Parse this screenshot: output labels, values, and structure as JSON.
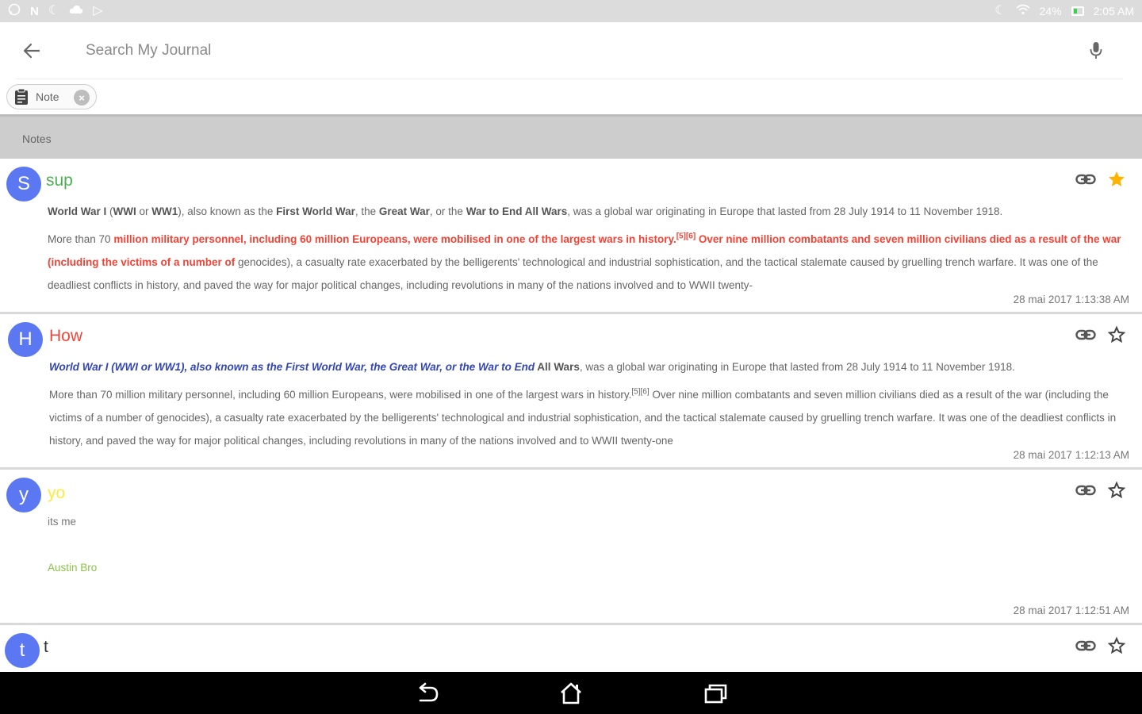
{
  "status_bar": {
    "left_icons": [
      "whatsapp-icon",
      "n-notification-icon",
      "moon-icon",
      "cloud-icon",
      "play-store-icon"
    ],
    "battery": "24%",
    "time": "2:05 AM"
  },
  "search": {
    "placeholder": "Search My Journal"
  },
  "filter_chip": {
    "label": "Note"
  },
  "section": {
    "title": "Notes"
  },
  "colors": {
    "avatar": "#5b78f2",
    "title_sup": "#4caf50",
    "title_how": "#f44336",
    "title_yo": "#ffeb3b",
    "title_t": "#333333",
    "star_active": "#ffb300",
    "highlight_red": "#f44336",
    "highlight_blue": "#3346b6",
    "signature_green": "#8bc34a"
  },
  "notes": [
    {
      "avatar": "S",
      "title": "sup",
      "starred": true,
      "line1": {
        "b1": "World War I",
        "t1": " (",
        "b2": "WWI",
        "t2": " or ",
        "b3": "WW1",
        "t3": "), also known as the ",
        "b4": "First World War",
        "t4": ", the ",
        "b5": "Great War",
        "t5": ", or the ",
        "b6": "War to End All Wars",
        "t6": ", was a global war originating in Europe that lasted from 28 July 1914 to 11 November 1918."
      },
      "para": {
        "t1": "More than 70 ",
        "r1": "million military personnel, including 60 million Europeans, were mobilised in one of the largest wars in history.",
        "ref": "[5][6]",
        "r2": " Over nine million combatants and seven million civilians died as a result of the war (including the victims of a number of",
        "t2": " genocides), a casualty rate exacerbated by the belligerents' technological and industrial sophistication, and the tactical stalemate caused by gruelling trench warfare. It was one of the deadliest conflicts in history, and paved the way for major political changes, including revolutions in many of the nations involved and to WWII twenty-"
      },
      "date": "28 mai 2017 1:13:38 AM"
    },
    {
      "avatar": "H",
      "title": "How",
      "starred": false,
      "line1": {
        "blue": "World War I (WWI or WW1), also known as the First World War, the Great War, or the War to End",
        "b1": " All Wars",
        "t1": ", was a global war originating in Europe that lasted from 28 July 1914 to 11 November 1918."
      },
      "para": {
        "t1": "More than 70 million military personnel, including 60 million Europeans, were mobilised in one of the largest wars in history.",
        "ref": "[5][6]",
        "t2": " Over nine million combatants and seven million civilians died as a result of the war (including the victims of a number of genocides), a casualty rate exacerbated by the belligerents' technological and industrial sophistication, and the tactical stalemate caused by gruelling trench warfare. It was one of the deadliest conflicts in history, and paved the way for major political changes, including revolutions in many of the nations involved and to WWII twenty-one"
      },
      "date": "28 mai 2017 1:12:13 AM"
    },
    {
      "avatar": "y",
      "title": "yo",
      "starred": false,
      "body": "its me",
      "signature": "Austin Bro",
      "date": "28 mai 2017 1:12:51 AM"
    },
    {
      "avatar": "t",
      "title": "t",
      "starred": false
    }
  ],
  "nav_bar": {
    "buttons": [
      "back-icon",
      "home-icon",
      "recents-icon"
    ]
  }
}
